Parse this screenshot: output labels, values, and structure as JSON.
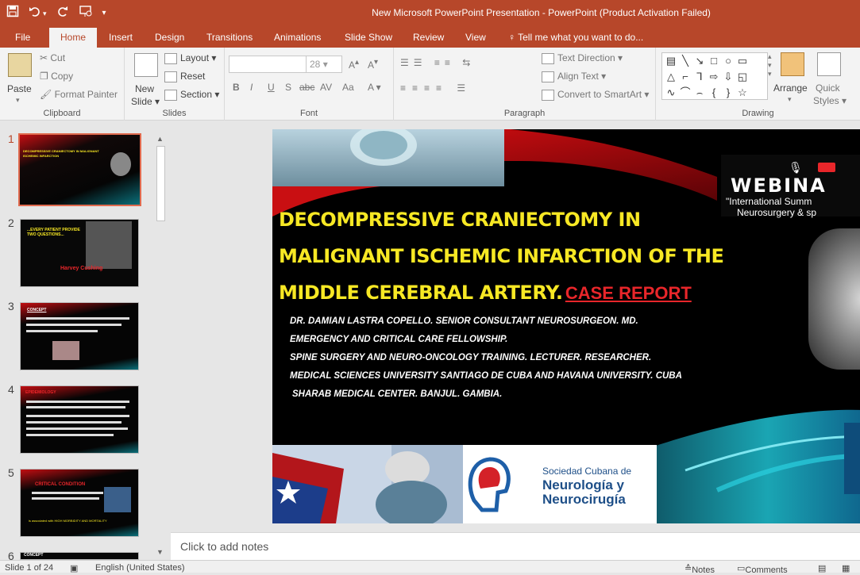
{
  "window": {
    "title": "New Microsoft PowerPoint Presentation - PowerPoint (Product Activation Failed)"
  },
  "qat": {
    "save_icon": "save-icon",
    "undo_icon": "undo-icon",
    "redo_icon": "redo-icon",
    "present_icon": "present-from-start-icon",
    "customize": "▾"
  },
  "tabs": [
    "File",
    "Home",
    "Insert",
    "Design",
    "Transitions",
    "Animations",
    "Slide Show",
    "Review",
    "View"
  ],
  "tell_me": "Tell me what you want to do...",
  "ribbon": {
    "clipboard": {
      "paste": "Paste",
      "cut": "Cut",
      "copy": "Copy",
      "format_painter": "Format Painter",
      "label": "Clipboard"
    },
    "slides": {
      "new_slide": "New",
      "new_slide2": "Slide",
      "layout": "Layout",
      "reset": "Reset",
      "section": "Section",
      "label": "Slides"
    },
    "font": {
      "size": "28",
      "label": "Font",
      "bold": "B",
      "italic": "I",
      "underline": "U",
      "shadow": "S",
      "strike": "abc",
      "spacing": "AV",
      "case": "Aa"
    },
    "paragraph": {
      "text_direction": "Text Direction",
      "align_text": "Align Text",
      "smartart": "Convert to SmartArt",
      "label": "Paragraph"
    },
    "drawing": {
      "arrange": "Arrange",
      "quick": "Quick",
      "styles": "Styles",
      "label": "Drawing"
    }
  },
  "thumbnails": [
    {
      "num": "1",
      "title": "DECOMPRESSIVE CRANIECTOMY IN MALIGNANT ISCHEMIC INFARCTION"
    },
    {
      "num": "2",
      "title": "...EVERY PATIENT PROVIDE TWO QUESTIONS...",
      "sub": "Harvey Cushing"
    },
    {
      "num": "3",
      "title": "CONCEPT"
    },
    {
      "num": "4",
      "title": "EPIDEMIOLOGY"
    },
    {
      "num": "5",
      "title": "CRITICAL CONDITION",
      "sub": "is associated with HIGH MORBIDITY AND MORTALITY"
    },
    {
      "num": "6",
      "title": "CONCEPT"
    }
  ],
  "slide": {
    "webinar": "WEBINA",
    "webinar_sub1": "\"International Summ",
    "webinar_sub2": "Neurosurgery & sp",
    "title_line1": "DECOMPRESSIVE CRANIECTOMY IN",
    "title_line2": "MALIGNANT ISCHEMIC INFARCTION OF THE",
    "title_line3": "MIDDLE CEREBRAL ARTERY.",
    "case_report": "CASE REPORT",
    "author_lines": [
      "DR. DAMIAN LASTRA COPELLO. SENIOR CONSULTANT NEUROSURGEON. MD.",
      "EMERGENCY AND CRITICAL CARE FELLOWSHIP.",
      "SPINE SURGERY AND NEURO-ONCOLOGY TRAINING. LECTURER. RESEARCHER.",
      "MEDICAL SCIENCES UNIVERSITY SANTIAGO DE CUBA AND HAVANA UNIVERSITY. CUBA",
      "SHARAB MEDICAL CENTER. BANJUL. GAMBIA."
    ],
    "logo_line1": "Sociedad Cubana de",
    "logo_line2": "Neurología y",
    "logo_line3": "Neurocirugía"
  },
  "notes_placeholder": "Click to add notes",
  "status": {
    "slide": "Slide 1 of 24",
    "language": "English (United States)",
    "notes": "Notes",
    "comments": "Comments"
  },
  "colors": {
    "accent": "#b7472a",
    "title_yellow": "#f7e824",
    "case_red": "#e8262a"
  }
}
